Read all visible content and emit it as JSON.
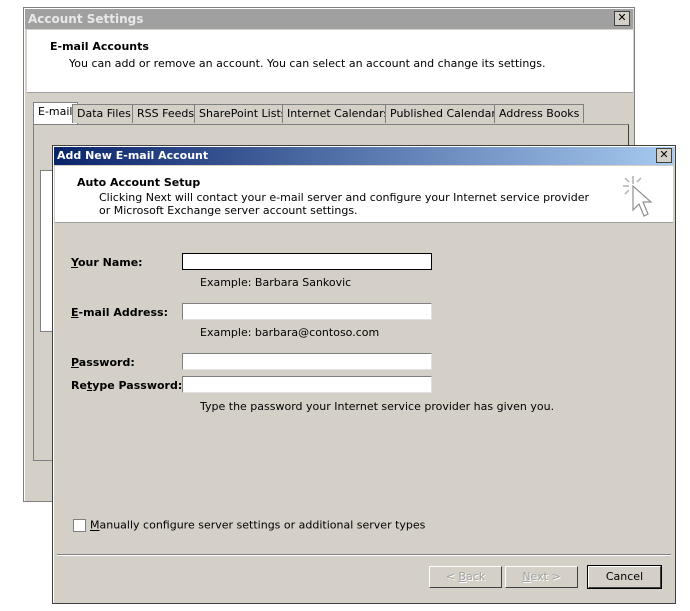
{
  "account_settings": {
    "title": "Account Settings",
    "close": "✕",
    "header_title": "E-mail Accounts",
    "header_desc": "You can add or remove an account. You can select an account and change its settings.",
    "tabs": [
      "E-mail",
      "Data Files",
      "RSS Feeds",
      "SharePoint Lists",
      "Internet Calendars",
      "Published Calendars",
      "Address Books"
    ]
  },
  "dialog": {
    "title": "Add New E-mail Account",
    "close": "✕",
    "header_title": "Auto Account Setup",
    "header_desc": "Clicking Next will contact your e-mail server and configure your Internet service provider or Microsoft Exchange server account settings.",
    "name_label_key": "Y",
    "name_label_rest": "our Name:",
    "name_value": "",
    "name_hint": "Example: Barbara Sankovic",
    "email_label_key": "E",
    "email_label_rest": "-mail Address:",
    "email_value": "",
    "email_hint": "Example: barbara@contoso.com",
    "password_label_key": "P",
    "password_label_rest": "assword:",
    "password_value": "",
    "retype_label_pre": "Re",
    "retype_label_key": "t",
    "retype_label_rest": "ype Password:",
    "retype_value": "",
    "password_hint": "Type the password your Internet service provider has given you.",
    "manual_key": "M",
    "manual_rest": "anually configure server settings or additional server types",
    "back_pre": "< ",
    "back_key": "B",
    "back_rest": "ack",
    "next_key": "N",
    "next_rest": "ext >",
    "cancel": "Cancel"
  }
}
